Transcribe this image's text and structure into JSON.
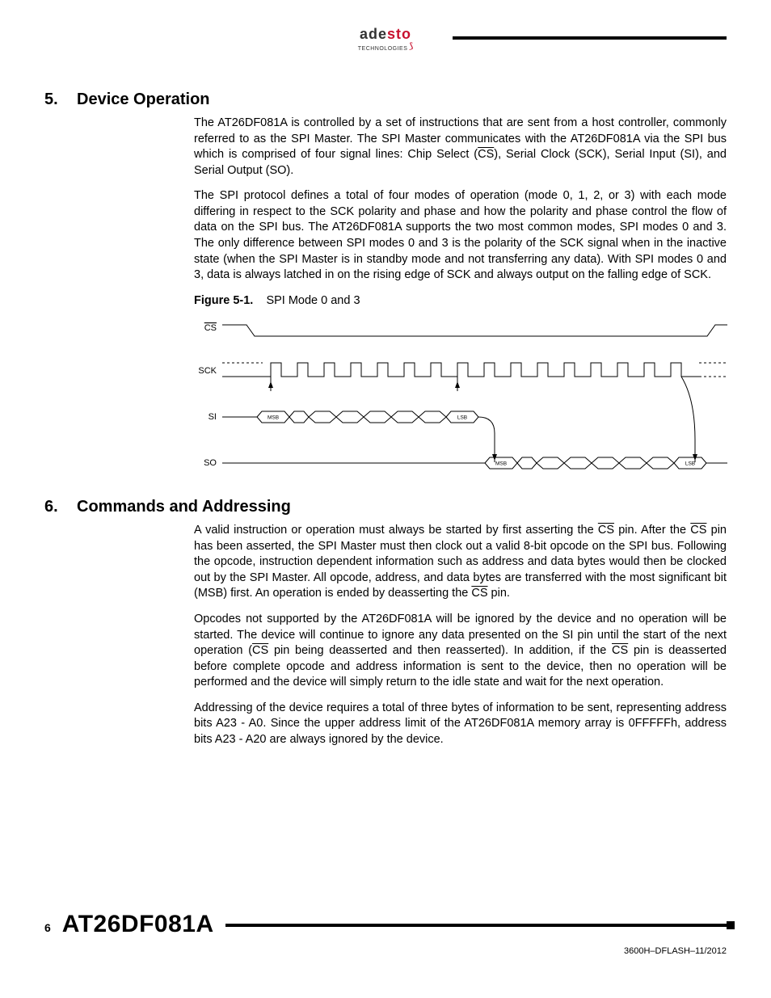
{
  "brand": {
    "name_plain": "ade",
    "name_accent": "sto",
    "tagline": "TECHNOLOGIES"
  },
  "sections": {
    "s5": {
      "num": "5.",
      "title": "Device Operation",
      "p1_a": "The AT26DF081A is controlled by a set of instructions that are sent from a host controller, commonly referred to as the SPI Master. The SPI Master communicates with the AT26DF081A via the SPI bus which is comprised of four signal lines: Chip Select (",
      "p1_cs": "CS",
      "p1_b": "), Serial Clock (SCK), Serial Input (SI), and Serial Output (SO).",
      "p2": "The SPI protocol defines a total of four modes of operation (mode 0, 1, 2, or 3) with each mode differing in respect to the SCK polarity and phase and how the polarity and phase control the flow of data on the SPI bus. The AT26DF081A supports the two most common modes, SPI modes 0 and 3. The only difference between SPI modes 0 and 3 is the polarity of the SCK signal when in the inactive state (when the SPI Master is in standby mode and not transferring any data). With SPI modes 0 and 3, data is always latched in on the rising edge of SCK and always output on the falling edge of SCK.",
      "fig_label": "Figure 5-1.",
      "fig_title": "SPI Mode 0 and 3",
      "signals": {
        "cs": "CS",
        "sck": "SCK",
        "si": "SI",
        "so": "SO",
        "msb": "MSB",
        "lsb": "LSB"
      }
    },
    "s6": {
      "num": "6.",
      "title": "Commands and Addressing",
      "p1_a": "A valid instruction or operation must always be started by first asserting the ",
      "p1_b": " pin. After the ",
      "p1_c": " pin has been asserted, the SPI Master must then clock out a valid 8-bit opcode on the SPI bus. Following the opcode, instruction dependent information such as address and data bytes would then be clocked out by the SPI Master. All opcode, address, and data bytes are transferred with the most significant bit (MSB) first. An operation is ended by deasserting the ",
      "p1_d": " pin.",
      "p2_a": "Opcodes not supported by the AT26DF081A will be ignored by the device and no operation will be started. The device will continue to ignore any data presented on the SI pin until the start of the next operation (",
      "p2_b": " pin being deasserted and then reasserted). In addition, if the ",
      "p2_c": " pin is deasserted before complete opcode and address information is sent to the device, then no operation will be performed and the device will simply return to the idle state and wait for the next operation.",
      "p3": "Addressing of the device requires a total of three bytes of information to be sent, representing address bits A23 - A0. Since the upper address limit of the AT26DF081A memory array is 0FFFFFh, address bits A23 - A20 are always ignored by the device."
    }
  },
  "footer": {
    "page": "6",
    "part": "AT26DF081A",
    "doc": "3600H–DFLASH–11/2012"
  }
}
